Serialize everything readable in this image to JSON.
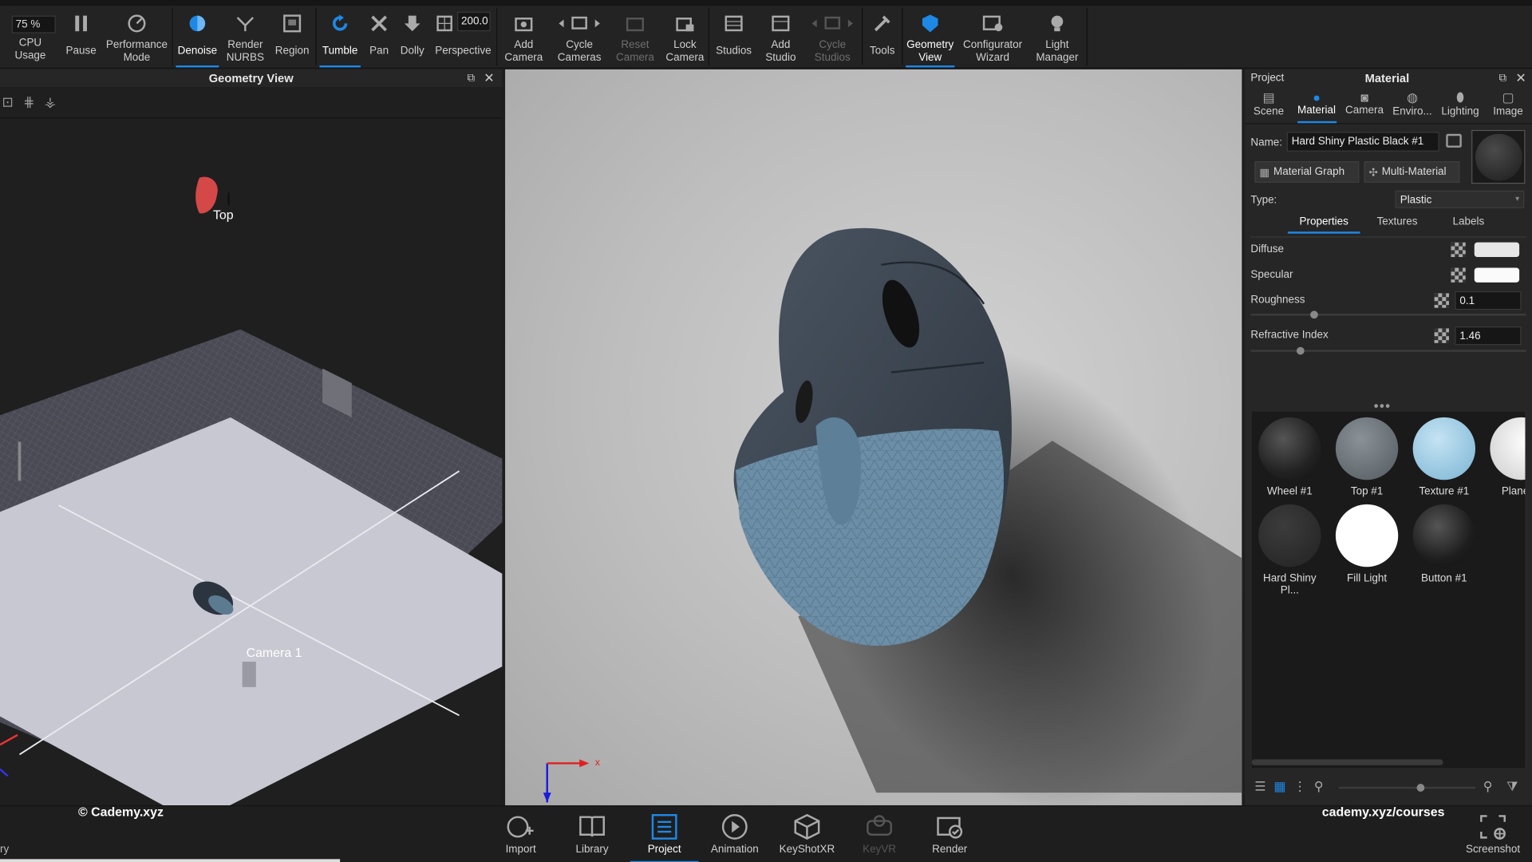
{
  "toolbar": {
    "zoom": "75 %",
    "cpu_usage": "CPU Usage",
    "pause": "Pause",
    "performance_mode": [
      "Performance",
      "Mode"
    ],
    "denoise": "Denoise",
    "render_nurbs": [
      "Render",
      "NURBS"
    ],
    "region": "Region",
    "tumble": "Tumble",
    "pan": "Pan",
    "dolly": "Dolly",
    "perspective": "Perspective",
    "perspective_value": "200.0",
    "add_camera": [
      "Add",
      "Camera"
    ],
    "cycle_cameras": [
      "Cycle",
      "Cameras"
    ],
    "reset_camera": [
      "Reset",
      "Camera"
    ],
    "lock_camera": [
      "Lock",
      "Camera"
    ],
    "studios": "Studios",
    "add_studio": [
      "Add",
      "Studio"
    ],
    "cycle_studios": [
      "Cycle",
      "Studios"
    ],
    "tools": "Tools",
    "geometry_view": [
      "Geometry",
      "View"
    ],
    "configurator_wizard": [
      "Configurator",
      "Wizard"
    ],
    "light_manager": [
      "Light",
      "Manager"
    ]
  },
  "geometry_view": {
    "title": "Geometry View",
    "label_top": "Top",
    "label_camera": "Camera 1"
  },
  "right_panel": {
    "project": "Project",
    "title": "Material",
    "tabs": [
      "Scene",
      "Material",
      "Camera",
      "Enviro...",
      "Lighting",
      "Image"
    ],
    "name_label": "Name:",
    "name_value": "Hard Shiny Plastic Black #1",
    "material_graph": "Material Graph",
    "multi_material": "Multi-Material",
    "type_label": "Type:",
    "type_value": "Plastic",
    "subtabs": [
      "Properties",
      "Textures",
      "Labels"
    ],
    "diffuse": "Diffuse",
    "specular": "Specular",
    "roughness": "Roughness",
    "roughness_value": "0.1",
    "roughness_level": 0.23,
    "refractive_index": "Refractive Index",
    "refractive_value": "1.46",
    "refractive_level": 0.18,
    "materials": [
      {
        "name": "Wheel #1"
      },
      {
        "name": "Top #1"
      },
      {
        "name": "Texture #1"
      },
      {
        "name": "Plane M"
      },
      {
        "name": "Hard Shiny Pl..."
      },
      {
        "name": "Fill Light"
      },
      {
        "name": "Button #1"
      }
    ]
  },
  "bottom": {
    "watermark_left": "© Cademy.xyz",
    "watermark_right": "cademy.xyz/courses",
    "items": [
      "Import",
      "Library",
      "Project",
      "Animation",
      "KeyShotXR",
      "KeyVR",
      "Render"
    ],
    "screenshot": "Screenshot",
    "corner_text": "ry"
  },
  "colors": {
    "accent": "#1e88e5",
    "mouse_top": "#3a4450",
    "mouse_bottom": "#6c8ea6"
  }
}
